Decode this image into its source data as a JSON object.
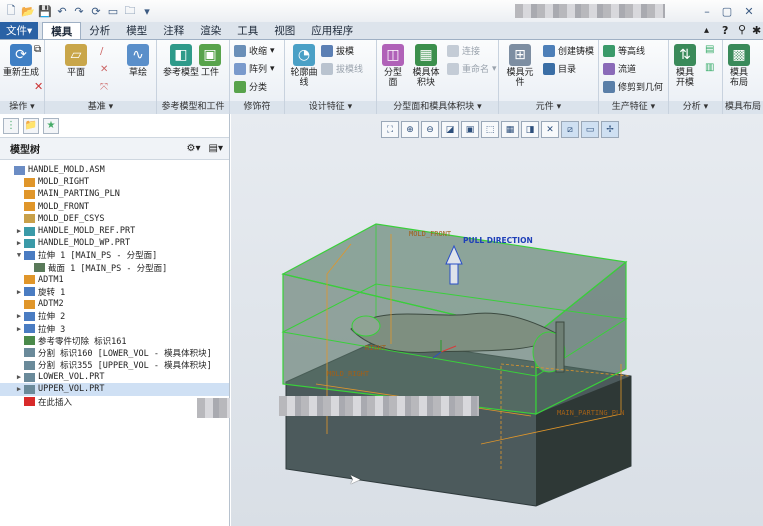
{
  "tabs": [
    "文件",
    "模具",
    "分析",
    "模型",
    "注释",
    "渲染",
    "工具",
    "视图",
    "应用程序"
  ],
  "groups": [
    {
      "label": "操作",
      "items": [
        "重新生成"
      ]
    },
    {
      "label": "基准",
      "items": [
        "平面",
        "草绘"
      ]
    },
    {
      "label": "参考模型和工件",
      "items": [
        "参考模型",
        "工件"
      ]
    },
    {
      "label": "修饰符",
      "items": [
        "收缩",
        "阵列",
        "分类"
      ]
    },
    {
      "label": "设计特征",
      "items": [
        "轮廓曲线",
        "拔模",
        "拔模线"
      ]
    },
    {
      "label": "分型面和模具体积块",
      "items": [
        "分型面",
        "模具体积块",
        "连接",
        "重命名"
      ]
    },
    {
      "label": "元件",
      "items": [
        "模具元件",
        "创建铸模",
        "目录"
      ]
    },
    {
      "label": "生产特征",
      "items": [
        "等高线",
        "流道",
        "修剪到几何"
      ]
    },
    {
      "label": "分析",
      "items": [
        "模具开模"
      ]
    },
    {
      "label": "模具布局",
      "items": [
        "模具布局"
      ]
    }
  ],
  "tree": {
    "title": "模型树",
    "rows": [
      {
        "text": "HANDLE_MOLD.ASM",
        "indent": 0,
        "exp": ""
      },
      {
        "text": "MOLD_RIGHT",
        "indent": 1,
        "exp": ""
      },
      {
        "text": "MAIN_PARTING_PLN",
        "indent": 1,
        "exp": ""
      },
      {
        "text": "MOLD_FRONT",
        "indent": 1,
        "exp": ""
      },
      {
        "text": "MOLD_DEF_CSYS",
        "indent": 1,
        "exp": ""
      },
      {
        "text": "HANDLE_MOLD_REF.PRT",
        "indent": 1,
        "exp": "▶"
      },
      {
        "text": "HANDLE_MOLD_WP.PRT",
        "indent": 1,
        "exp": "▶"
      },
      {
        "text": "拉伸 1 [MAIN_PS - 分型面]",
        "indent": 1,
        "exp": "▼"
      },
      {
        "text": "截面 1 [MAIN_PS - 分型面]",
        "indent": 2,
        "exp": ""
      },
      {
        "text": "ADTM1",
        "indent": 1,
        "exp": ""
      },
      {
        "text": "旋转 1",
        "indent": 1,
        "exp": "▶"
      },
      {
        "text": "ADTM2",
        "indent": 1,
        "exp": ""
      },
      {
        "text": "拉伸 2",
        "indent": 1,
        "exp": "▶"
      },
      {
        "text": "拉伸 3",
        "indent": 1,
        "exp": "▶"
      },
      {
        "text": "参考零件切除 标识161",
        "indent": 1,
        "exp": ""
      },
      {
        "text": "分割 标识160 [LOWER_VOL - 模具体积块]",
        "indent": 1,
        "exp": ""
      },
      {
        "text": "分割 标识355 [UPPER_VOL - 模具体积块]",
        "indent": 1,
        "exp": ""
      },
      {
        "text": "LOWER_VOL.PRT",
        "indent": 1,
        "exp": "▶"
      },
      {
        "text": "UPPER_VOL.PRT",
        "indent": 1,
        "exp": "▶"
      },
      {
        "text": "在此插入",
        "indent": 1,
        "exp": ""
      }
    ]
  },
  "viewport": {
    "labels": [
      "MOLD_FRONT",
      "PULL DIRECTION",
      "MOLD_RIGHT",
      "RIGHT",
      "MAIN_PARTING_PLN"
    ]
  }
}
